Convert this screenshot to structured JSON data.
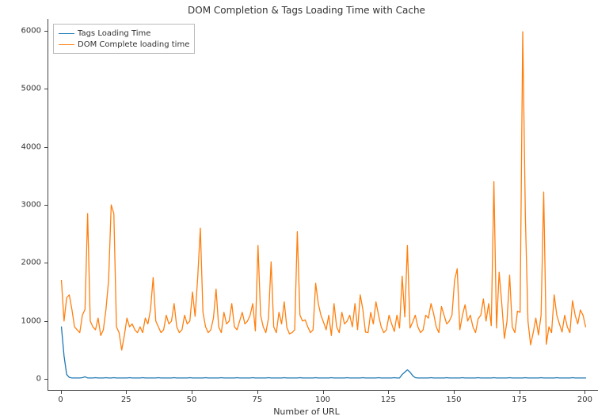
{
  "chart_data": {
    "type": "line",
    "title": "DOM Completion & Tags Loading Time with Cache",
    "xlabel": "Number of URL",
    "ylabel": "",
    "xlim": [
      -5,
      205
    ],
    "ylim": [
      -200,
      6200
    ],
    "xticks": [
      0,
      25,
      50,
      75,
      100,
      125,
      150,
      175,
      200
    ],
    "yticks": [
      0,
      1000,
      2000,
      3000,
      4000,
      5000,
      6000
    ],
    "legend_position": "upper-left",
    "series": [
      {
        "name": "Tags Loading Time",
        "color": "#1f77b4",
        "x": [
          0,
          1,
          2,
          3,
          4,
          5,
          6,
          7,
          8,
          9,
          10,
          11,
          12,
          13,
          14,
          15,
          16,
          17,
          18,
          19,
          20,
          21,
          22,
          23,
          24,
          25,
          26,
          27,
          28,
          29,
          30,
          31,
          32,
          33,
          34,
          35,
          36,
          37,
          38,
          39,
          40,
          41,
          42,
          43,
          44,
          45,
          46,
          47,
          48,
          49,
          50,
          51,
          52,
          53,
          54,
          55,
          56,
          57,
          58,
          59,
          60,
          61,
          62,
          63,
          64,
          65,
          66,
          67,
          68,
          69,
          70,
          71,
          72,
          73,
          74,
          75,
          76,
          77,
          78,
          79,
          80,
          81,
          82,
          83,
          84,
          85,
          86,
          87,
          88,
          89,
          90,
          91,
          92,
          93,
          94,
          95,
          96,
          97,
          98,
          99,
          100,
          101,
          102,
          103,
          104,
          105,
          106,
          107,
          108,
          109,
          110,
          111,
          112,
          113,
          114,
          115,
          116,
          117,
          118,
          119,
          120,
          121,
          122,
          123,
          124,
          125,
          126,
          127,
          128,
          129,
          130,
          131,
          132,
          133,
          134,
          135,
          136,
          137,
          138,
          139,
          140,
          141,
          142,
          143,
          144,
          145,
          146,
          147,
          148,
          149,
          150,
          151,
          152,
          153,
          154,
          155,
          156,
          157,
          158,
          159,
          160,
          161,
          162,
          163,
          164,
          165,
          166,
          167,
          168,
          169,
          170,
          171,
          172,
          173,
          174,
          175,
          176,
          177,
          178,
          179,
          180,
          181,
          182,
          183,
          184,
          185,
          186,
          187,
          188,
          189,
          190,
          191,
          192,
          193,
          194,
          195,
          196,
          197,
          198,
          199,
          200
        ],
        "values": [
          900,
          400,
          80,
          30,
          20,
          20,
          20,
          20,
          25,
          40,
          20,
          20,
          20,
          25,
          20,
          20,
          20,
          25,
          20,
          20,
          25,
          20,
          20,
          20,
          20,
          20,
          25,
          20,
          20,
          20,
          20,
          25,
          20,
          20,
          20,
          20,
          20,
          25,
          20,
          20,
          20,
          20,
          20,
          25,
          20,
          20,
          20,
          20,
          20,
          25,
          20,
          20,
          20,
          20,
          20,
          25,
          20,
          20,
          20,
          20,
          20,
          25,
          20,
          20,
          20,
          20,
          20,
          25,
          20,
          20,
          20,
          20,
          20,
          25,
          20,
          20,
          20,
          20,
          20,
          25,
          20,
          20,
          20,
          20,
          20,
          25,
          20,
          20,
          20,
          20,
          20,
          25,
          20,
          20,
          20,
          20,
          20,
          25,
          20,
          20,
          20,
          20,
          20,
          25,
          20,
          20,
          20,
          20,
          20,
          25,
          20,
          20,
          20,
          20,
          20,
          25,
          20,
          20,
          20,
          20,
          20,
          25,
          20,
          20,
          20,
          20,
          20,
          25,
          20,
          20,
          80,
          120,
          160,
          120,
          60,
          25,
          20,
          20,
          20,
          20,
          20,
          25,
          20,
          20,
          20,
          20,
          20,
          25,
          20,
          20,
          20,
          20,
          20,
          25,
          20,
          20,
          20,
          20,
          20,
          25,
          20,
          20,
          20,
          20,
          20,
          25,
          20,
          20,
          20,
          20,
          20,
          25,
          20,
          20,
          20,
          20,
          20,
          25,
          20,
          20,
          20,
          20,
          20,
          25,
          20,
          20,
          20,
          20,
          20,
          25,
          20,
          20,
          20,
          20,
          20,
          25,
          20,
          20,
          20,
          20,
          20
        ]
      },
      {
        "name": "DOM Complete loading time",
        "color": "#ff7f0e",
        "x": [
          0,
          1,
          2,
          3,
          4,
          5,
          6,
          7,
          8,
          9,
          10,
          11,
          12,
          13,
          14,
          15,
          16,
          17,
          18,
          19,
          20,
          21,
          22,
          23,
          24,
          25,
          26,
          27,
          28,
          29,
          30,
          31,
          32,
          33,
          34,
          35,
          36,
          37,
          38,
          39,
          40,
          41,
          42,
          43,
          44,
          45,
          46,
          47,
          48,
          49,
          50,
          51,
          52,
          53,
          54,
          55,
          56,
          57,
          58,
          59,
          60,
          61,
          62,
          63,
          64,
          65,
          66,
          67,
          68,
          69,
          70,
          71,
          72,
          73,
          74,
          75,
          76,
          77,
          78,
          79,
          80,
          81,
          82,
          83,
          84,
          85,
          86,
          87,
          88,
          89,
          90,
          91,
          92,
          93,
          94,
          95,
          96,
          97,
          98,
          99,
          100,
          101,
          102,
          103,
          104,
          105,
          106,
          107,
          108,
          109,
          110,
          111,
          112,
          113,
          114,
          115,
          116,
          117,
          118,
          119,
          120,
          121,
          122,
          123,
          124,
          125,
          126,
          127,
          128,
          129,
          130,
          131,
          132,
          133,
          134,
          135,
          136,
          137,
          138,
          139,
          140,
          141,
          142,
          143,
          144,
          145,
          146,
          147,
          148,
          149,
          150,
          151,
          152,
          153,
          154,
          155,
          156,
          157,
          158,
          159,
          160,
          161,
          162,
          163,
          164,
          165,
          166,
          167,
          168,
          169,
          170,
          171,
          172,
          173,
          174,
          175,
          176,
          177,
          178,
          179,
          180,
          181,
          182,
          183,
          184,
          185,
          186,
          187,
          188,
          189,
          190,
          191,
          192,
          193,
          194,
          195,
          196,
          197,
          198,
          199,
          200
        ],
        "values": [
          1700,
          1000,
          1400,
          1450,
          1200,
          900,
          850,
          800,
          1100,
          1200,
          2850,
          1000,
          900,
          850,
          1050,
          750,
          850,
          1200,
          1700,
          3000,
          2850,
          900,
          800,
          500,
          750,
          1050,
          900,
          950,
          850,
          800,
          900,
          800,
          1050,
          950,
          1200,
          1750,
          1000,
          900,
          800,
          850,
          1100,
          950,
          1000,
          1300,
          900,
          800,
          850,
          1100,
          950,
          1000,
          1500,
          1080,
          1750,
          2600,
          1150,
          900,
          800,
          850,
          1050,
          1550,
          900,
          800,
          1150,
          950,
          1000,
          1300,
          900,
          850,
          1000,
          1150,
          950,
          1000,
          1100,
          1300,
          830,
          2300,
          1100,
          900,
          800,
          1050,
          2020,
          900,
          800,
          1150,
          950,
          1330,
          890,
          780,
          800,
          850,
          2540,
          1100,
          1000,
          1020,
          900,
          800,
          850,
          1650,
          1300,
          1100,
          980,
          850,
          1100,
          750,
          1300,
          900,
          800,
          1150,
          950,
          1000,
          1100,
          900,
          1300,
          850,
          1450,
          1200,
          810,
          800,
          1150,
          950,
          1330,
          1100,
          900,
          800,
          850,
          1100,
          950,
          820,
          1100,
          880,
          1770,
          1070,
          2300,
          880,
          980,
          1100,
          900,
          800,
          850,
          1100,
          1050,
          1300,
          1130,
          900,
          800,
          1250,
          1100,
          950,
          1000,
          1100,
          1700,
          1900,
          850,
          1100,
          1280,
          1000,
          1100,
          900,
          800,
          1040,
          1100,
          1380,
          1000,
          1300,
          920,
          3400,
          880,
          1840,
          1300,
          700,
          1000,
          1790,
          900,
          800,
          1170,
          1150,
          5980,
          2810,
          1000,
          590,
          800,
          1050,
          760,
          1100,
          3220,
          600,
          900,
          800,
          1450,
          1100,
          950,
          810,
          1100,
          900,
          800,
          1350,
          1100,
          950,
          1190,
          1100,
          900
        ]
      }
    ]
  }
}
